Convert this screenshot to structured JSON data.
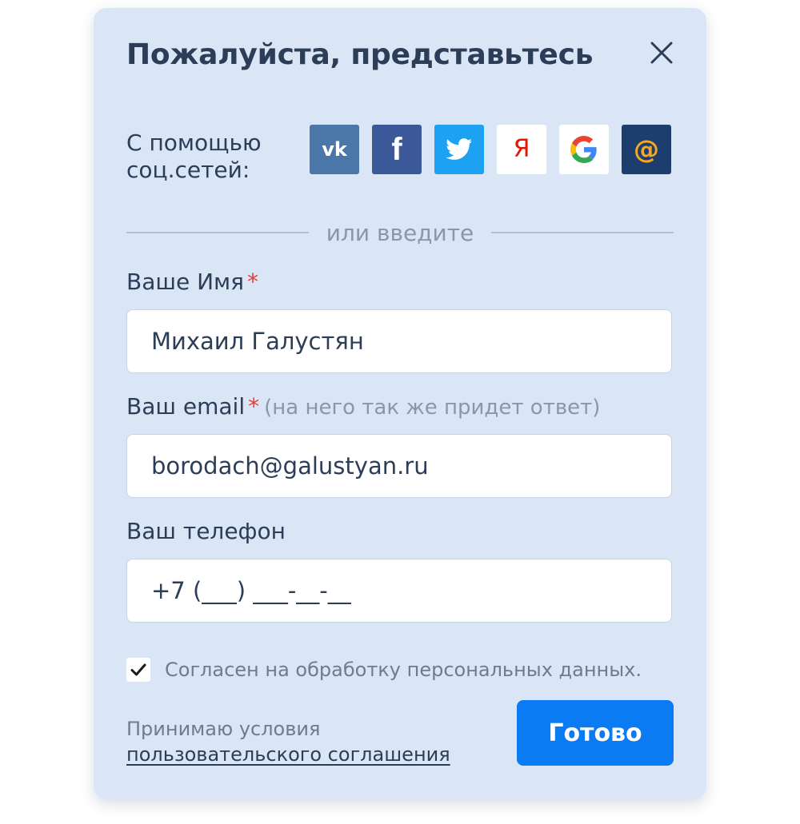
{
  "modal": {
    "title": "Пожалуйста, представьтесь"
  },
  "social": {
    "label_line1": "С помощью",
    "label_line2": "соц.сетей:",
    "buttons": [
      {
        "name": "vk",
        "icon": "vk-icon",
        "glyph": "vk",
        "color": "#4a76a8"
      },
      {
        "name": "facebook",
        "icon": "facebook-icon",
        "glyph": "f",
        "color": "#3b5998"
      },
      {
        "name": "twitter",
        "icon": "twitter-icon",
        "color": "#1da1f2"
      },
      {
        "name": "yandex",
        "icon": "yandex-icon",
        "glyph": "Я",
        "color": "#e61400"
      },
      {
        "name": "google",
        "icon": "google-icon",
        "glyph": "G",
        "color": "#4285f4"
      },
      {
        "name": "mailru",
        "icon": "mailru-icon",
        "glyph": "@",
        "color": "#f5a623"
      }
    ]
  },
  "divider": {
    "text": "или введите"
  },
  "form": {
    "name_label": "Ваше Имя",
    "name_required": "*",
    "name_value": "Михаил Галустян",
    "email_label": "Ваш email",
    "email_required": "*",
    "email_hint": "(на него так же придет ответ)",
    "email_value": "borodach@galustyan.ru",
    "phone_label": "Ваш телефон",
    "phone_placeholder": "+7 (___) ___-__-__"
  },
  "consent": {
    "checked": true,
    "text": "Согласен на обработку персональных данных."
  },
  "terms": {
    "prefix": "Принимаю условия",
    "link": "пользовательского соглашения"
  },
  "submit": {
    "label": "Готово",
    "color": "#0a7bf2"
  },
  "colors": {
    "panel_background": "#dae6f6",
    "title_text": "#2c3e57",
    "required_mark": "#e0403a"
  }
}
